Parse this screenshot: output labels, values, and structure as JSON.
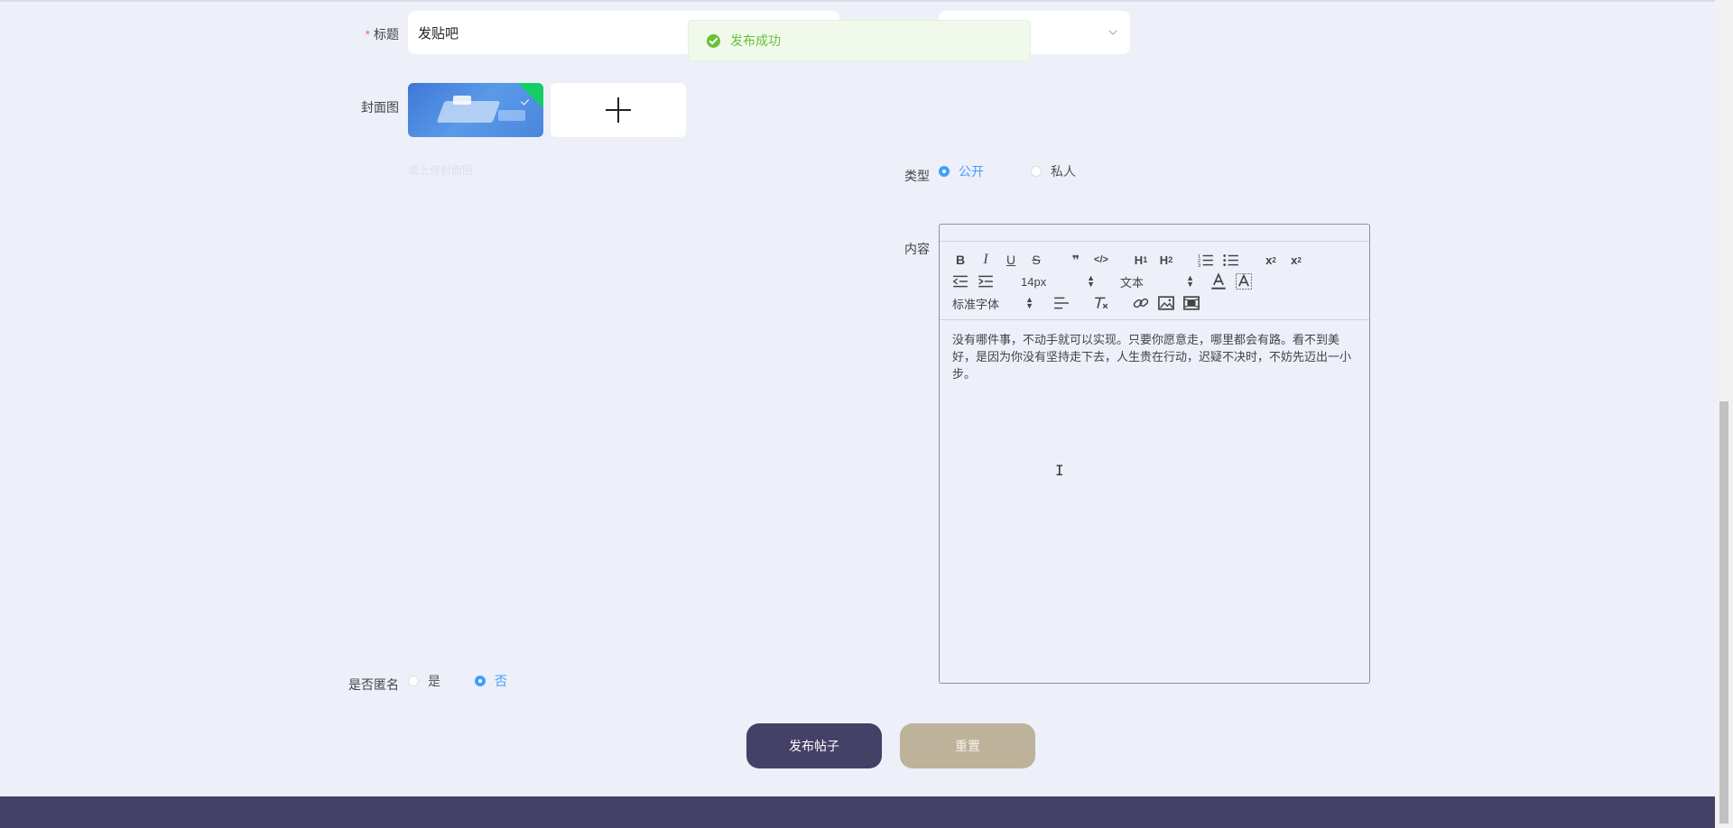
{
  "form": {
    "title_label": "标题",
    "title_required_mark": "*",
    "title_value": "发贴吧",
    "cover_label": "封面图",
    "cover_hint": "请上传封面图",
    "type_label": "类型",
    "type_options": [
      "公开",
      "私人"
    ],
    "type_selected": "公开",
    "content_label": "内容",
    "anonymous_label": "是否匿名",
    "anonymous_options": [
      "是",
      "否"
    ],
    "anonymous_selected": "否"
  },
  "toast": {
    "message": "发布成功",
    "color": "#67c23a"
  },
  "editor": {
    "toolbar": {
      "bold": "B",
      "italic": "I",
      "underline": "U",
      "strike": "S",
      "blockquote": "❞",
      "code": "</>",
      "h1": "H1",
      "h2": "H2",
      "font_size": "14px",
      "header_picker": "文本",
      "font_family": "标准字体"
    },
    "content": "没有哪件事，不动手就可以实现。只要你愿意走，哪里都会有路。看不到美好，是因为你没有坚持走下去，人生贵在行动，迟疑不决时，不妨先迈出一小步。"
  },
  "buttons": {
    "submit": "发布帖子",
    "reset": "重置"
  },
  "colors": {
    "page_bg": "#edeff9",
    "primary": "#444066",
    "reset": "#bdb29a",
    "radio_active": "#409eff"
  }
}
